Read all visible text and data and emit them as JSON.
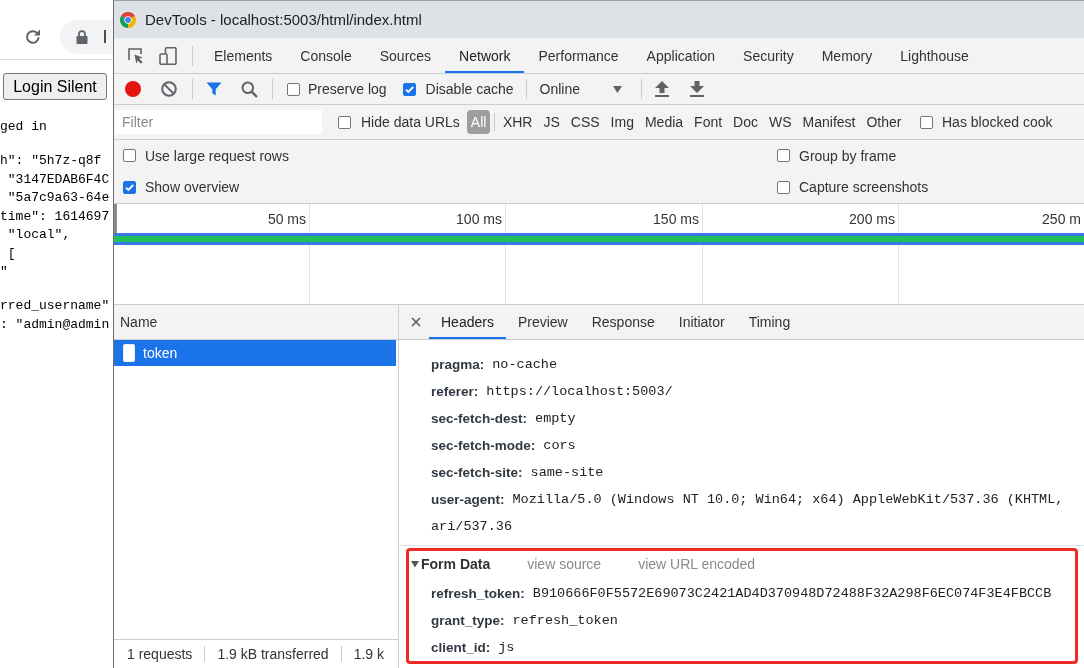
{
  "browser": {
    "address": "l",
    "button": "Login Silent",
    "status": "ged in",
    "json_blocks": [
      [
        "h\": \"5h7z-q8f",
        " \"3147EDAB6F4C",
        " \"5a7c9a63-64e",
        "time\": 1614697",
        " \"local\",",
        " [",
        "\""
      ],
      [
        "rred_username\"",
        ": \"admin@admin"
      ]
    ]
  },
  "devtools": {
    "title": "DevTools - localhost:5003/html/index.html",
    "panel_tabs": [
      {
        "label": "Elements",
        "selected": false
      },
      {
        "label": "Console",
        "selected": false
      },
      {
        "label": "Sources",
        "selected": false
      },
      {
        "label": "Network",
        "selected": true
      },
      {
        "label": "Performance",
        "selected": false
      },
      {
        "label": "Application",
        "selected": false
      },
      {
        "label": "Security",
        "selected": false
      },
      {
        "label": "Memory",
        "selected": false
      },
      {
        "label": "Lighthouse",
        "selected": false
      }
    ],
    "toolbar": {
      "recording": true,
      "checkboxes": [
        {
          "label": "Preserve log",
          "checked": false
        },
        {
          "label": "Disable cache",
          "checked": true
        }
      ],
      "throttling": "Online"
    },
    "filter": {
      "placeholder": "Filter",
      "hide_data_urls": {
        "label": "Hide data URLs",
        "checked": false
      },
      "types": [
        {
          "label": "All",
          "selected": true
        },
        {
          "label": "XHR",
          "selected": false
        },
        {
          "label": "JS",
          "selected": false
        },
        {
          "label": "CSS",
          "selected": false
        },
        {
          "label": "Img",
          "selected": false
        },
        {
          "label": "Media",
          "selected": false
        },
        {
          "label": "Font",
          "selected": false
        },
        {
          "label": "Doc",
          "selected": false
        },
        {
          "label": "WS",
          "selected": false
        },
        {
          "label": "Manifest",
          "selected": false
        },
        {
          "label": "Other",
          "selected": false
        }
      ],
      "blocked_cookies": {
        "label": "Has blocked cook",
        "checked": false
      }
    },
    "options": [
      {
        "label": "Use large request rows",
        "checked": false
      },
      {
        "label": "Group by frame",
        "checked": false
      },
      {
        "label": "Show overview",
        "checked": true
      },
      {
        "label": "Capture screenshots",
        "checked": false
      }
    ],
    "timeline": {
      "ticks": [
        "50 ms",
        "100 ms",
        "150 ms",
        "200 ms",
        "250 m"
      ]
    },
    "requests": {
      "column": "Name",
      "rows": [
        {
          "name": "token",
          "selected": true
        }
      ],
      "summary": [
        "1 requests",
        "1.9 kB transferred",
        "1.9 k"
      ]
    },
    "details": {
      "tabs": [
        {
          "label": "Headers",
          "selected": true
        },
        {
          "label": "Preview",
          "selected": false
        },
        {
          "label": "Response",
          "selected": false
        },
        {
          "label": "Initiator",
          "selected": false
        },
        {
          "label": "Timing",
          "selected": false
        }
      ],
      "headers": [
        {
          "name": "pragma:",
          "value": "no-cache"
        },
        {
          "name": "referer:",
          "value": "https://localhost:5003/"
        },
        {
          "name": "sec-fetch-dest:",
          "value": "empty"
        },
        {
          "name": "sec-fetch-mode:",
          "value": "cors"
        },
        {
          "name": "sec-fetch-site:",
          "value": "same-site"
        },
        {
          "name": "user-agent:",
          "value": "Mozilla/5.0 (Windows NT 10.0; Win64; x64) AppleWebKit/537.36 (KHTML,",
          "continuation": "ari/537.36"
        }
      ],
      "form_data": {
        "title": "Form Data",
        "expanded": true,
        "highlighted": true,
        "links": [
          "view source",
          "view URL encoded"
        ],
        "fields": [
          {
            "name": "refresh_token:",
            "value": "B910666F0F5572E69073C2421AD4D370948D72488F32A298F6EC074F3E4FBCCB"
          },
          {
            "name": "grant_type:",
            "value": "refresh_token"
          },
          {
            "name": "client_id:",
            "value": "js"
          }
        ]
      }
    }
  }
}
